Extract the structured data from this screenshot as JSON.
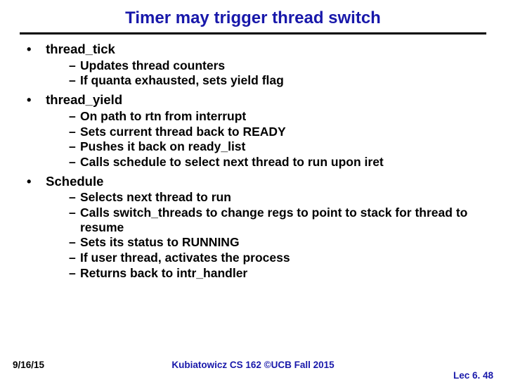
{
  "title": "Timer may trigger thread switch",
  "bullets": {
    "b1": "thread_tick",
    "b1s": {
      "s1": "Updates thread counters",
      "s2": "If quanta exhausted, sets yield flag"
    },
    "b2": "thread_yield",
    "b2s": {
      "s1": "On path to rtn from interrupt",
      "s2": "Sets current thread back to READY",
      "s3": "Pushes it back on ready_list",
      "s4": "Calls schedule to select next thread to run upon iret"
    },
    "b3": "Schedule",
    "b3s": {
      "s1": "Selects next thread to run",
      "s2": "Calls switch_threads to change regs to point to stack for thread to resume",
      "s3": "Sets its status to RUNNING",
      "s4": "If user thread, activates the process",
      "s5": "Returns back to intr_handler"
    }
  },
  "footer": {
    "date": "9/16/15",
    "center": "Kubiatowicz CS 162 ©UCB Fall 2015",
    "page": "Lec 6. 48"
  }
}
